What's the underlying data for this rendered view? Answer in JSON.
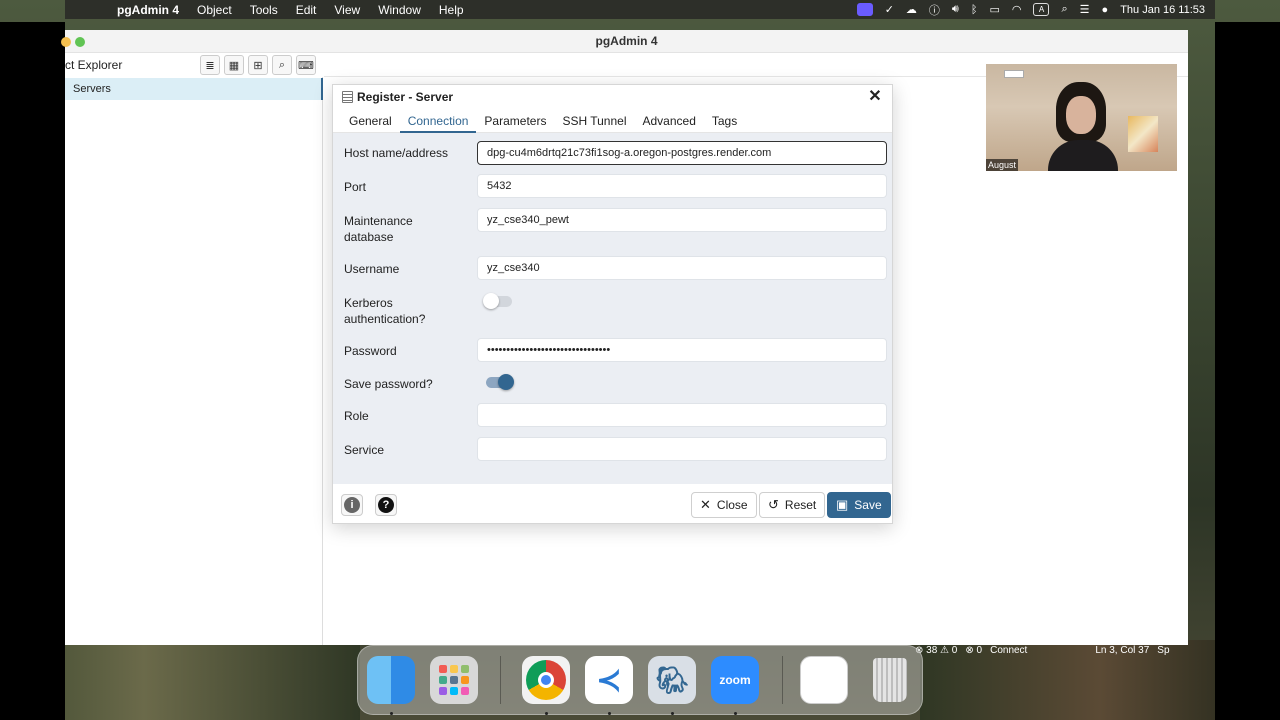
{
  "menubar": {
    "app_name": "pgAdmin 4",
    "items": [
      "Object",
      "Tools",
      "Edit",
      "View",
      "Window",
      "Help"
    ],
    "clock": "Thu Jan 16  11:53"
  },
  "window": {
    "title": "pgAdmin 4"
  },
  "explorer": {
    "title": "ct Explorer",
    "tree": [
      {
        "label": "Servers"
      }
    ]
  },
  "dialog": {
    "title": "Register - Server",
    "tabs": [
      "General",
      "Connection",
      "Parameters",
      "SSH Tunnel",
      "Advanced",
      "Tags"
    ],
    "active_tab": "Connection",
    "fields": {
      "host": {
        "label": "Host name/address",
        "value": "dpg-cu4m6drtq21c73fi1sog-a.oregon-postgres.render.com"
      },
      "port": {
        "label": "Port",
        "value": "5432"
      },
      "maintenance_db": {
        "label_line1": "Maintenance",
        "label_line2": "database",
        "value": "yz_cse340_pewt"
      },
      "username": {
        "label": "Username",
        "value": "yz_cse340"
      },
      "kerberos": {
        "label_line1": "Kerberos",
        "label_line2": "authentication?",
        "enabled": false
      },
      "password": {
        "label": "Password",
        "value": "••••••••••••••••••••••••••••••••"
      },
      "save_password": {
        "label": "Save password?",
        "enabled": true
      },
      "role": {
        "label": "Role",
        "value": ""
      },
      "service": {
        "label": "Service",
        "value": ""
      }
    },
    "footer": {
      "info_label": "i",
      "help_label": "?",
      "close_label": "Close",
      "reset_label": "Reset",
      "save_label": "Save"
    }
  },
  "statusbar": {
    "problems": "⊗ 38 ⚠ 0",
    "ports": "⊗ 0",
    "connect": "Connect",
    "position": "Ln 3, Col 37",
    "extra": "Sp"
  },
  "camera": {
    "participant_name": "August"
  },
  "dock": {
    "apps": [
      "Finder",
      "Launchpad",
      "Google Chrome",
      "Visual Studio Code",
      "pgAdmin 4",
      "Zoom",
      "Preview",
      "Trash"
    ],
    "zoom_label": "zoom"
  },
  "colors": {
    "accent": "#326690",
    "dialog_body": "#ebeef3"
  }
}
